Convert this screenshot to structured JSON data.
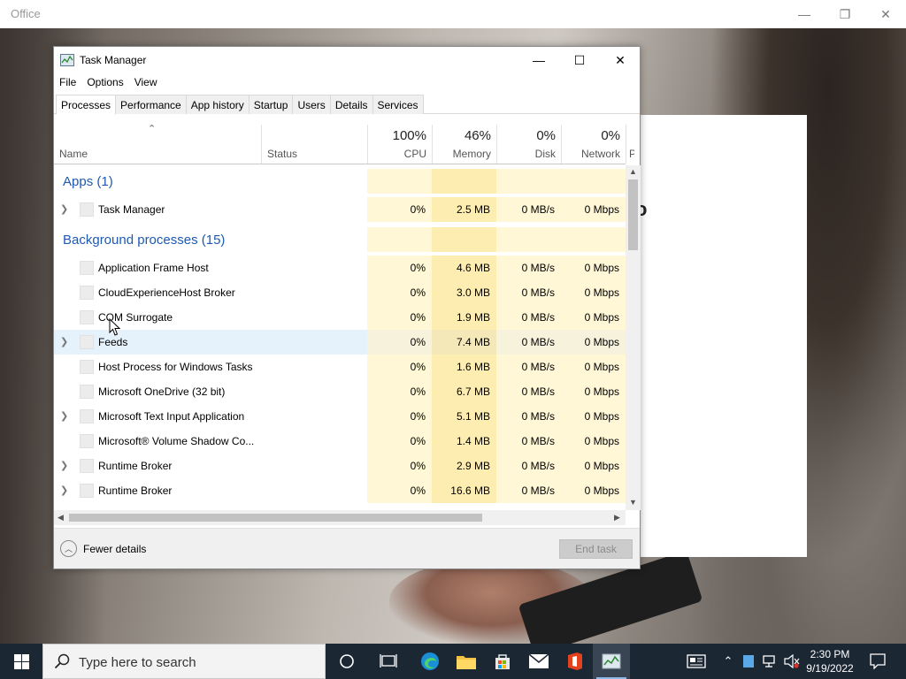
{
  "office": {
    "title": "Office",
    "glyph": "o"
  },
  "window": {
    "title": "Task Manager",
    "controls": {
      "minimize": "—",
      "maximize": "☐",
      "close": "✕"
    }
  },
  "menu": [
    "File",
    "Options",
    "View"
  ],
  "tabs": [
    "Processes",
    "Performance",
    "App history",
    "Startup",
    "Users",
    "Details",
    "Services"
  ],
  "columns": {
    "name": "Name",
    "status": "Status",
    "cpu": {
      "pct": "100%",
      "label": "CPU"
    },
    "memory": {
      "pct": "46%",
      "label": "Memory"
    },
    "disk": {
      "pct": "0%",
      "label": "Disk"
    },
    "network": {
      "pct": "0%",
      "label": "Network"
    },
    "power": "P"
  },
  "groups": [
    {
      "title": "Apps (1)",
      "processes": [
        {
          "name": "Task Manager",
          "expandable": true,
          "cpu": "0%",
          "memory": "2.5 MB",
          "disk": "0 MB/s",
          "network": "0 Mbps"
        }
      ]
    },
    {
      "title": "Background processes (15)",
      "processes": [
        {
          "name": "Application Frame Host",
          "expandable": false,
          "cpu": "0%",
          "memory": "4.6 MB",
          "disk": "0 MB/s",
          "network": "0 Mbps"
        },
        {
          "name": "CloudExperienceHost Broker",
          "expandable": false,
          "cpu": "0%",
          "memory": "3.0 MB",
          "disk": "0 MB/s",
          "network": "0 Mbps"
        },
        {
          "name": "COM Surrogate",
          "expandable": false,
          "cpu": "0%",
          "memory": "1.9 MB",
          "disk": "0 MB/s",
          "network": "0 Mbps"
        },
        {
          "name": "Feeds",
          "expandable": true,
          "hover": true,
          "cpu": "0%",
          "memory": "7.4 MB",
          "disk": "0 MB/s",
          "network": "0 Mbps"
        },
        {
          "name": "Host Process for Windows Tasks",
          "expandable": false,
          "cpu": "0%",
          "memory": "1.6 MB",
          "disk": "0 MB/s",
          "network": "0 Mbps"
        },
        {
          "name": "Microsoft OneDrive (32 bit)",
          "expandable": false,
          "cpu": "0%",
          "memory": "6.7 MB",
          "disk": "0 MB/s",
          "network": "0 Mbps"
        },
        {
          "name": "Microsoft Text Input Application",
          "expandable": true,
          "cpu": "0%",
          "memory": "5.1 MB",
          "disk": "0 MB/s",
          "network": "0 Mbps"
        },
        {
          "name": "Microsoft® Volume Shadow Co...",
          "expandable": false,
          "cpu": "0%",
          "memory": "1.4 MB",
          "disk": "0 MB/s",
          "network": "0 Mbps"
        },
        {
          "name": "Runtime Broker",
          "expandable": true,
          "cpu": "0%",
          "memory": "2.9 MB",
          "disk": "0 MB/s",
          "network": "0 Mbps"
        },
        {
          "name": "Runtime Broker",
          "expandable": true,
          "cpu": "0%",
          "memory": "16.6 MB",
          "disk": "0 MB/s",
          "network": "0 Mbps"
        }
      ]
    }
  ],
  "footer": {
    "fewer_details": "Fewer details",
    "end_task": "End task"
  },
  "taskbar": {
    "search_placeholder": "Type here to search",
    "apps": [
      "cortana-icon",
      "task-view-icon",
      "edge-icon",
      "file-explorer-icon",
      "store-icon",
      "mail-icon",
      "office-icon",
      "task-manager-icon"
    ],
    "time": "2:30 PM",
    "date": "9/19/2022"
  },
  "colors": {
    "accent": "#1e5ab4",
    "heat_light": "#fff7d6",
    "heat_mem": "#fdedb1",
    "taskbar": "#1c2734"
  }
}
